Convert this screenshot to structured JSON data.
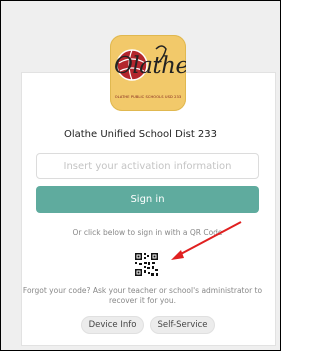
{
  "logo": {
    "script_text": "Olathe",
    "tagline": "OLATHE PUBLIC SCHOOLS USD 233",
    "colors": {
      "background": "#f2c96a",
      "emblem": "#b3262d"
    }
  },
  "district_name": "Olathe Unified School Dist 233",
  "activation_input": {
    "placeholder": "Insert your activation information",
    "value": ""
  },
  "sign_in_label": "Sign in",
  "qr_hint": "Or click below to sign in with a QR Code",
  "forgot_text": "Forgot your code? Ask your teacher or school's administrator to recover it for you.",
  "footer_buttons": {
    "device_info": "Device Info",
    "self_service": "Self-Service"
  },
  "icons": [
    "qr-code-icon",
    "annotation-arrow-icon"
  ],
  "colors": {
    "accent": "#5fab9e",
    "arrow": "#e02020",
    "page_background": "#efefef"
  }
}
